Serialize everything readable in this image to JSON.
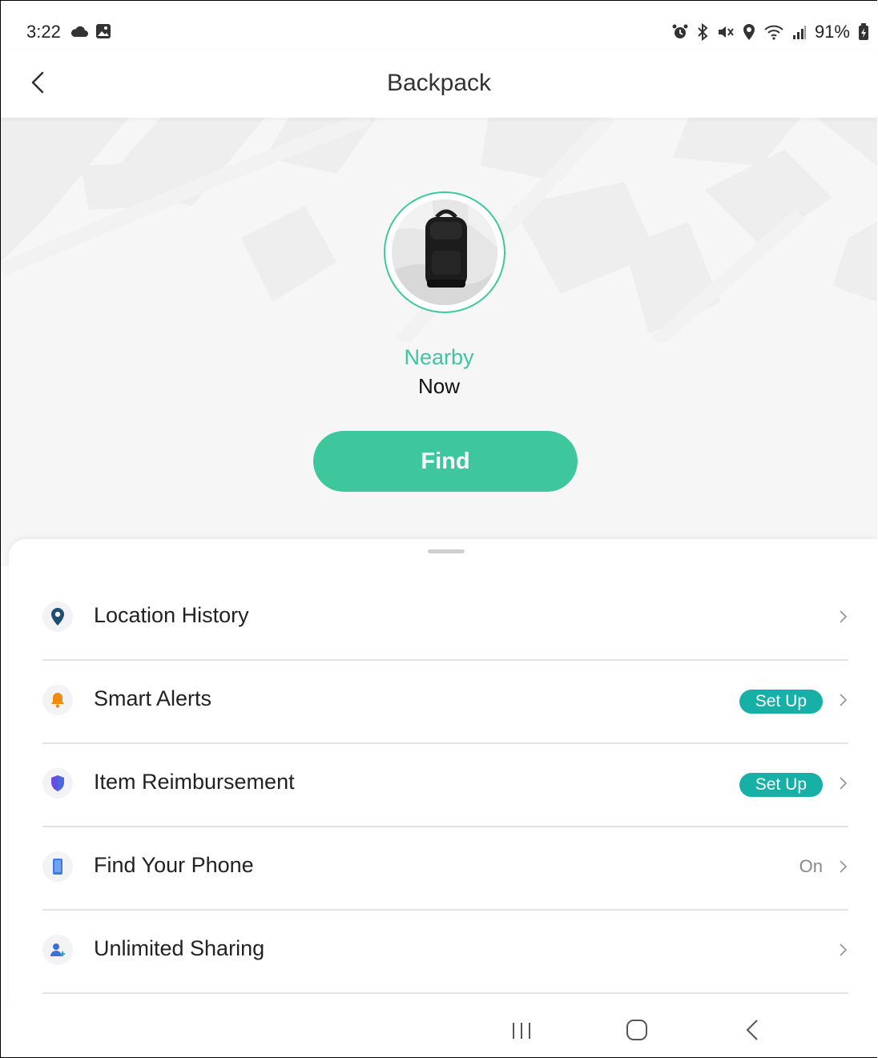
{
  "status_bar": {
    "time": "3:22",
    "battery": "91%",
    "left_icons": [
      "cloud-icon",
      "gallery-icon"
    ],
    "right_icons": [
      "alarm-icon",
      "bluetooth-icon",
      "mute-icon",
      "location-icon",
      "wifi-icon",
      "signal-icon",
      "battery-icon"
    ]
  },
  "header": {
    "title": "Backpack",
    "back_icon": "chevron-left-icon"
  },
  "device": {
    "status": "Nearby",
    "last_seen": "Now",
    "find_label": "Find"
  },
  "menu": {
    "items": [
      {
        "label": "Location History",
        "icon": "map-pin-icon",
        "icon_color": "#1d4e73",
        "badge": "",
        "value": ""
      },
      {
        "label": "Smart Alerts",
        "icon": "bell-icon",
        "icon_color": "#f08a12",
        "badge": "Set Up",
        "value": ""
      },
      {
        "label": "Item Reimbursement",
        "icon": "shield-icon",
        "icon_color": "#6a4ce0",
        "badge": "Set Up",
        "value": ""
      },
      {
        "label": "Find Your Phone",
        "icon": "phone-icon",
        "icon_color": "#3d7be0",
        "badge": "",
        "value": "On"
      },
      {
        "label": "Unlimited Sharing",
        "icon": "add-person-icon",
        "icon_color": "#3d6fd8",
        "badge": "",
        "value": ""
      }
    ]
  },
  "colors": {
    "accent": "#3ec79d",
    "badge": "#17b0a7"
  },
  "nav_bar": {
    "buttons": [
      "recent-apps-icon",
      "home-icon",
      "back-icon"
    ]
  }
}
